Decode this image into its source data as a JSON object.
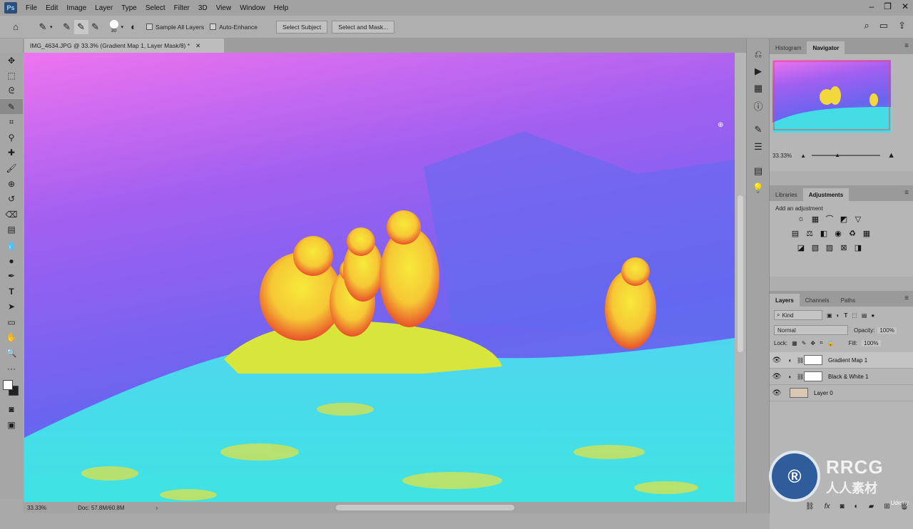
{
  "app": {
    "logo": "Ps",
    "menu": [
      "File",
      "Edit",
      "Image",
      "Layer",
      "Type",
      "Select",
      "Filter",
      "3D",
      "View",
      "Window",
      "Help"
    ],
    "window_controls": [
      "minimize-icon",
      "restore-icon",
      "close-icon"
    ]
  },
  "options": {
    "brush_size": "30",
    "sample_all_layers": "Sample All Layers",
    "auto_enhance": "Auto-Enhance",
    "select_subject": "Select Subject",
    "select_and_mask": "Select and Mask..."
  },
  "document": {
    "tab_title": "IMG_4634.JPG @ 33.3% (Gradient Map 1, Layer Mask/8) *",
    "zoom": "33.33%",
    "doc_size": "Doc: 57.8M/60.8M"
  },
  "panels": {
    "navigator_tabs": [
      "Histogram",
      "Navigator"
    ],
    "navigator_zoom": "33.33%",
    "adjust_tabs": [
      "Libraries",
      "Adjustments"
    ],
    "add_adjustment": "Add an adjustment",
    "layer_tabs": [
      "Layers",
      "Channels",
      "Paths"
    ],
    "kind": "Kind",
    "blend_mode": "Normal",
    "opacity_label": "Opacity:",
    "opacity_value": "100%",
    "lock_label": "Lock:",
    "fill_label": "Fill:",
    "fill_value": "100%",
    "layers": [
      {
        "name": "Gradient Map 1",
        "selected": true
      },
      {
        "name": "Black & White 1",
        "selected": false
      },
      {
        "name": "Layer 0",
        "selected": false
      }
    ]
  },
  "watermark": {
    "brand": "RRCG",
    "sub": "人人素材",
    "udemy": "Udemy"
  },
  "colors": {
    "sky_top": "#e070e8",
    "sky_bottom": "#6a5cf0",
    "ground": "#43e0e8",
    "subject": "#f5e23a",
    "subject_hot": "#e8402a"
  }
}
